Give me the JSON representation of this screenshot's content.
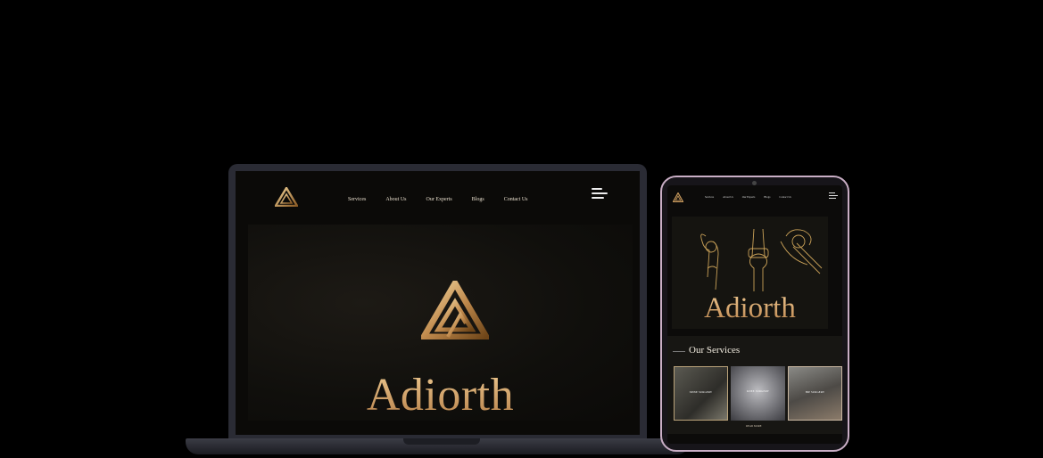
{
  "laptop": {
    "nav": {
      "items": [
        "Services",
        "About Us",
        "Our Experts",
        "Blogs",
        "Contact Us"
      ]
    },
    "hero": {
      "brand": "Adiorth"
    }
  },
  "tablet": {
    "nav": {
      "items": [
        "Services",
        "About Us",
        "Our Experts",
        "Blogs",
        "Contact Us"
      ]
    },
    "hero": {
      "brand": "Adiorth"
    },
    "services": {
      "title": "Our Services",
      "cards": [
        {
          "caption": "SPINE SURGERY"
        },
        {
          "caption": "KNEE SURGERY"
        },
        {
          "caption": "HIP SURGERY"
        }
      ],
      "more_label": "READ MORE"
    }
  },
  "colors": {
    "gold": "#d7a96c",
    "background": "#000000"
  },
  "icons": [
    "adiorth-logo-icon",
    "hamburger-menu-icon"
  ]
}
